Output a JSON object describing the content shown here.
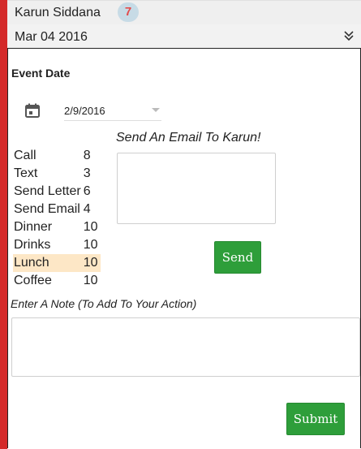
{
  "header": {
    "contact_name": "Karun Siddana",
    "badge_count": "7",
    "date": "Mar 04 2016",
    "accent_color": "#d42a2a",
    "badge_color": "#c7dbe6"
  },
  "form": {
    "event_date_label": "Event Date",
    "event_date_value": "2/9/2016",
    "actions": [
      {
        "label": "Call",
        "count": "8",
        "highlighted": false
      },
      {
        "label": "Text",
        "count": "3",
        "highlighted": false
      },
      {
        "label": "Send Letter",
        "count": "6",
        "highlighted": false
      },
      {
        "label": "Send Email",
        "count": "4",
        "highlighted": false
      },
      {
        "label": "Dinner",
        "count": "10",
        "highlighted": false
      },
      {
        "label": "Drinks",
        "count": "10",
        "highlighted": false
      },
      {
        "label": "Lunch",
        "count": "10",
        "highlighted": true
      },
      {
        "label": "Coffee",
        "count": "10",
        "highlighted": false
      }
    ],
    "email_title": "Send An Email To Karun!",
    "email_value": "",
    "send_label": "Send",
    "note_label": "Enter A Note (To Add To Your Action)",
    "note_value": "",
    "submit_label": "Submit",
    "button_color": "#2e9e3a",
    "highlight_color": "#fde7c6"
  },
  "icons": {
    "collapse": "chevron-double-down-icon",
    "calendar": "calendar-icon"
  }
}
